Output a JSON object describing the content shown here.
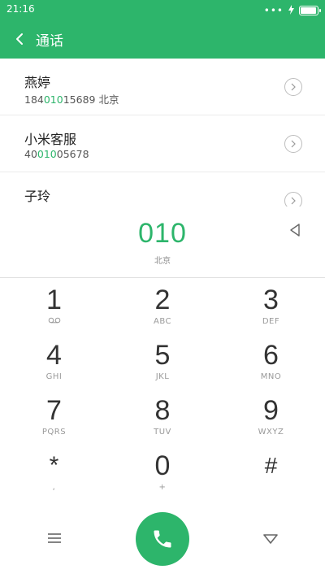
{
  "status_bar": {
    "time": "21:16",
    "dots": "•••",
    "battery_level": 0.95
  },
  "header": {
    "title": "通话",
    "back_icon": "chevron-left-icon"
  },
  "contacts": [
    {
      "name": "燕婷",
      "number_pre": "184",
      "number_hl": "010",
      "number_post": "15689",
      "location": "北京"
    },
    {
      "name": "小米客服",
      "number_pre": "40",
      "number_hl": "010",
      "number_post": "05678",
      "location": ""
    },
    {
      "name": "子玲",
      "number_pre": "",
      "number_hl": "",
      "number_post": "",
      "location": ""
    }
  ],
  "dial_input": {
    "value": "010",
    "location": "北京"
  },
  "keypad": [
    {
      "digit": "1",
      "letters": "",
      "sub_icon": "voicemail-icon"
    },
    {
      "digit": "2",
      "letters": "ABC"
    },
    {
      "digit": "3",
      "letters": "DEF"
    },
    {
      "digit": "4",
      "letters": "GHI"
    },
    {
      "digit": "5",
      "letters": "JKL"
    },
    {
      "digit": "6",
      "letters": "MNO"
    },
    {
      "digit": "7",
      "letters": "PQRS"
    },
    {
      "digit": "8",
      "letters": "TUV"
    },
    {
      "digit": "9",
      "letters": "WXYZ"
    },
    {
      "digit": "*",
      "letters": ","
    },
    {
      "digit": "0",
      "letters": "+"
    },
    {
      "digit": "#",
      "letters": ""
    }
  ],
  "colors": {
    "accent": "#2db56b",
    "digit": "#333333",
    "sub": "#999999"
  }
}
